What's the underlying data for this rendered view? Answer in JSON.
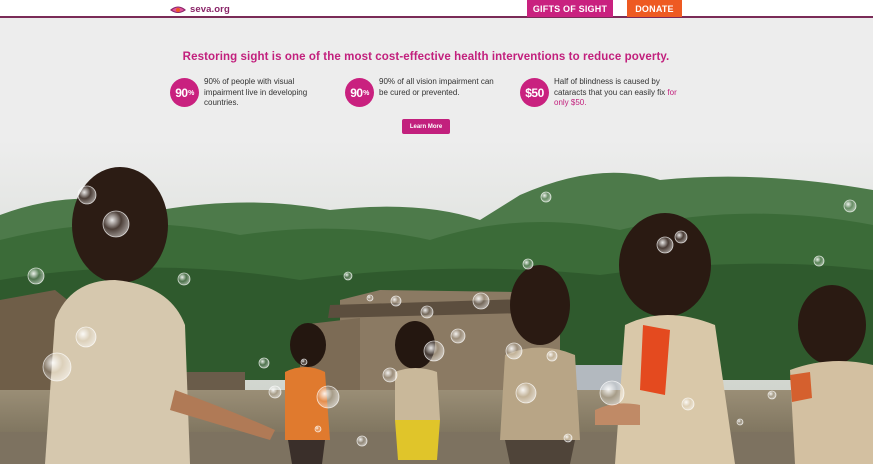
{
  "nav": {
    "logo_text": "seva.org",
    "gifts_label": "GIFTS OF SIGHT",
    "donate_label": "DONATE"
  },
  "info": {
    "headline": "Restoring sight is one of the most cost-effective health interventions to reduce poverty.",
    "stats": [
      {
        "badge_main": "90",
        "badge_suffix": "%",
        "text": "90% of people with visual impairment live in developing countries."
      },
      {
        "badge_main": "90",
        "badge_suffix": "%",
        "text": "90% of all vision impairment can be cured or prevented."
      },
      {
        "badge_main": "$50",
        "badge_suffix": "",
        "text": "Half of blindness is caused by cataracts that you can easily fix ",
        "text_highlight": "for only $50."
      }
    ],
    "learn_more_label": "Learn More"
  },
  "colors": {
    "brand_pink": "#c9217f",
    "donate_orange": "#ee5a22",
    "logo_purple": "#8a2468"
  }
}
